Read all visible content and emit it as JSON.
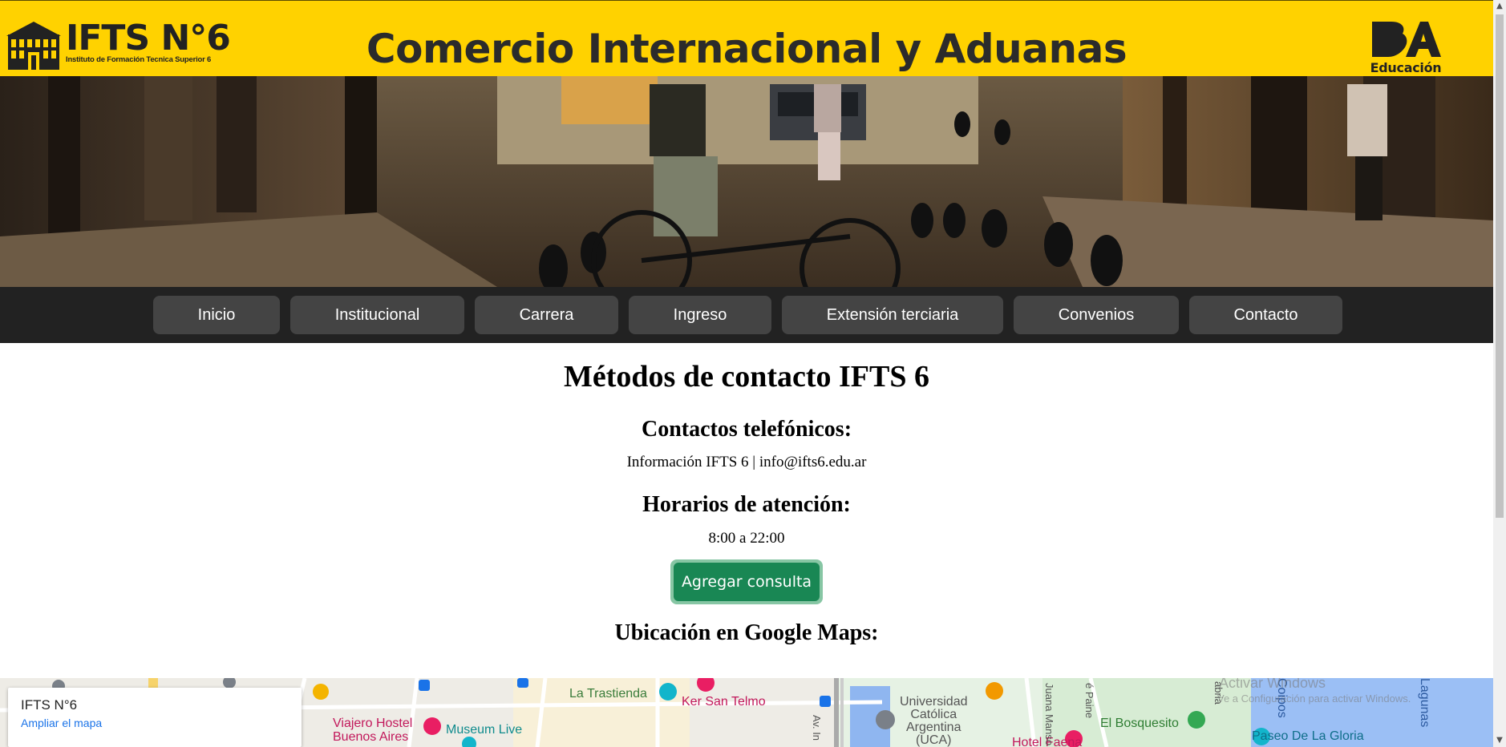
{
  "header": {
    "logo_main": "IFTS N°6",
    "logo_sub": "Instituto de Formación Tecnica Superior 6",
    "site_title": "Comercio Internacional y Aduanas",
    "ba_logo_text": "BA",
    "ba_label": "Educación",
    "brand_color": "#ffd200"
  },
  "nav": {
    "items": [
      {
        "label": "Inicio"
      },
      {
        "label": "Institucional"
      },
      {
        "label": "Carrera"
      },
      {
        "label": "Ingreso"
      },
      {
        "label": "Extensión terciaria"
      },
      {
        "label": "Convenios"
      },
      {
        "label": "Contacto"
      }
    ]
  },
  "main": {
    "title": "Métodos de contacto IFTS 6",
    "phone_heading": "Contactos telefónicos:",
    "phone_text": "Información IFTS 6 | info@ifts6.edu.ar",
    "hours_heading": "Horarios de atención:",
    "hours_text": "8:00 a 22:00",
    "button_label": "Agregar consulta",
    "button_color": "#198754",
    "map_heading": "Ubicación en Google Maps:"
  },
  "map": {
    "card_title": "IFTS N°6",
    "card_link": "Ampliar el mapa",
    "labels": {
      "trastienda": "La Trastienda",
      "ker": "Ker San Telmo",
      "viajero1": "Viajero Hostel",
      "viajero2": "Buenos Aires",
      "museum": "Museum Live",
      "av": "Av. In",
      "uca1": "Universidad",
      "uca2": "Católica",
      "uca3": "Argentina",
      "uca4": "(UCA)",
      "faena": "Hotel Faena",
      "manso": "Juana Manso",
      "paine": "é Paine",
      "bosquesito": "El Bosquesito",
      "gloria": "Paseo De La Gloria",
      "lagunas": "Lagunas",
      "coipos": "Coipos",
      "abria": "abria",
      "activar": "Activar Windows",
      "activar_sub": "Ve a Configuración para activar Windows."
    }
  }
}
